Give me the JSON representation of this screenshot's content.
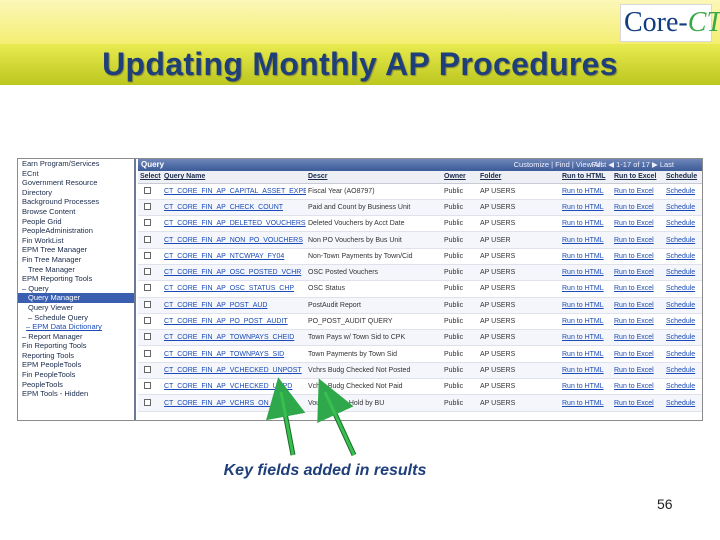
{
  "slide": {
    "title": "Updating Monthly AP Procedures",
    "logo_text": "Core-",
    "logo_ct": "CT",
    "callout": "Key fields added in results",
    "page_number": "56"
  },
  "sidebar": {
    "items": [
      {
        "label": "Earn Program/Services",
        "style": "plain"
      },
      {
        "label": "ECnt",
        "style": "plain"
      },
      {
        "label": "Government Resource",
        "style": "plain"
      },
      {
        "label": "Directory",
        "style": "plain"
      },
      {
        "label": "Background Processes",
        "style": "plain"
      },
      {
        "label": "Browse Content",
        "style": "plain"
      },
      {
        "label": "People Grid",
        "style": "plain"
      },
      {
        "label": "PeopleAdministration",
        "style": "plain"
      },
      {
        "label": "Fin WorkList",
        "style": "plain"
      },
      {
        "label": "EPM Tree Manager",
        "style": "plain"
      },
      {
        "label": "Fin Tree Manager",
        "style": "plain"
      },
      {
        "label": "Tree Manager",
        "style": "sub"
      },
      {
        "label": "EPM Reporting Tools",
        "style": "plain"
      },
      {
        "label": "– Query",
        "style": "plain"
      },
      {
        "label": "Query Manager",
        "style": "sel"
      },
      {
        "label": "Query Viewer",
        "style": "sub"
      },
      {
        "label": "– Schedule Query",
        "style": "sub"
      },
      {
        "label": "– EPM Data Dictionary",
        "style": "link"
      },
      {
        "label": "– Report Manager",
        "style": "plain"
      },
      {
        "label": "Fin Reporting Tools",
        "style": "plain"
      },
      {
        "label": "Reporting Tools",
        "style": "plain"
      },
      {
        "label": "EPM PeopleTools",
        "style": "plain"
      },
      {
        "label": "Fin PeopleTools",
        "style": "plain"
      },
      {
        "label": "PeopleTools",
        "style": "plain"
      },
      {
        "label": "EPM Tools - Hidden",
        "style": "plain"
      }
    ]
  },
  "query_panel": {
    "title": "Query",
    "find_label": "Customize | Find | View All",
    "nav_label": "First ◀ 1-17 of 17 ▶ Last",
    "columns": [
      "Select",
      "Query Name",
      "Descr",
      "Owner",
      "Folder",
      "Run to HTML",
      "Run to Excel",
      "Schedule"
    ],
    "rows": [
      {
        "name": "CT_CORE_FIN_AP_CAPITAL_ASSET_EXPEND",
        "descr": "Fiscal Year (AO8797)",
        "owner": "Public",
        "folder": "AP USERS",
        "html": "Run to HTML",
        "excel": "Run to Excel",
        "sched": "Schedule"
      },
      {
        "name": "CT_CORE_FIN_AP_CHECK_COUNT",
        "descr": "Paid and Count by Business Unit",
        "owner": "Public",
        "folder": "AP USERS",
        "html": "Run to HTML",
        "excel": "Run to Excel",
        "sched": "Schedule"
      },
      {
        "name": "CT_CORE_FIN_AP_DELETED_VOUCHERS",
        "descr": "Deleted Vouchers by Acct Date",
        "owner": "Public",
        "folder": "AP USERS",
        "html": "Run to HTML",
        "excel": "Run to Excel",
        "sched": "Schedule"
      },
      {
        "name": "CT_CORE_FIN_AP_NON_PO_VOUCHERS",
        "descr": "Non PO Vouchers by Bus Unit",
        "owner": "Public",
        "folder": "AP USER",
        "html": "Run to HTML",
        "excel": "Run to Excel",
        "sched": "Schedule"
      },
      {
        "name": "CT_CORE_FIN_AP_NTCWPAY_FY04",
        "descr": "Non-Town Payments by Town/Cid",
        "owner": "Public",
        "folder": "AP USERS",
        "html": "Run to HTML",
        "excel": "Run to Excel",
        "sched": "Schedule"
      },
      {
        "name": "CT_CORE_FIN_AP_OSC_POSTED_VCHR",
        "descr": "OSC Posted Vouchers",
        "owner": "Public",
        "folder": "AP USERS",
        "html": "Run to HTML",
        "excel": "Run to Excel",
        "sched": "Schedule"
      },
      {
        "name": "CT_CORE_FIN_AP_OSC_STATUS_CHP",
        "descr": "OSC Status",
        "owner": "Public",
        "folder": "AP USERS",
        "html": "Run to HTML",
        "excel": "Run to Excel",
        "sched": "Schedule"
      },
      {
        "name": "CT_CORE_FIN_AP_POST_AUD",
        "descr": "PostAudit Report",
        "owner": "Public",
        "folder": "AP USERS",
        "html": "Run to HTML",
        "excel": "Run to Excel",
        "sched": "Schedule"
      },
      {
        "name": "CT_CORE_FIN_AP_PO_POST_AUDIT",
        "descr": "PO_POST_AUDIT QUERY",
        "owner": "Public",
        "folder": "AP USERS",
        "html": "Run to HTML",
        "excel": "Run to Excel",
        "sched": "Schedule"
      },
      {
        "name": "CT_CORE_FIN_AP_TOWNPAYS_CHEID",
        "descr": "Town Pays w/ Town Sid to CPK",
        "owner": "Public",
        "folder": "AP USERS",
        "html": "Run to HTML",
        "excel": "Run to Excel",
        "sched": "Schedule"
      },
      {
        "name": "CT_CORE_FIN_AP_TOWNPAYS_SID",
        "descr": "Town Payments by Town Sid",
        "owner": "Public",
        "folder": "AP USERS",
        "html": "Run to HTML",
        "excel": "Run to Excel",
        "sched": "Schedule"
      },
      {
        "name": "CT_CORE_FIN_AP_VCHECKED_UNPOST",
        "descr": "Vchrs Budg Checked Not Posted",
        "owner": "Public",
        "folder": "AP USERS",
        "html": "Run to HTML",
        "excel": "Run to Excel",
        "sched": "Schedule"
      },
      {
        "name": "CT_CORE_FIN_AP_VCHECKED_UNPD",
        "descr": "Vchrs Budg Checked Not Paid",
        "owner": "Public",
        "folder": "AP USERS",
        "html": "Run to HTML",
        "excel": "Run to Excel",
        "sched": "Schedule"
      },
      {
        "name": "CT_CORE_FIN_AP_VCHRS_ON_HOLD",
        "descr": "Vouchers on Hold by BU",
        "owner": "Public",
        "folder": "AP USERS",
        "html": "Run to HTML",
        "excel": "Run to Excel",
        "sched": "Schedule"
      }
    ]
  },
  "colors": {
    "title": "#1f3f7a",
    "arrow": "#2ea84a",
    "header_bar": "#3b5a98",
    "selection": "#3a5fb0",
    "link": "#1a4bb8"
  }
}
